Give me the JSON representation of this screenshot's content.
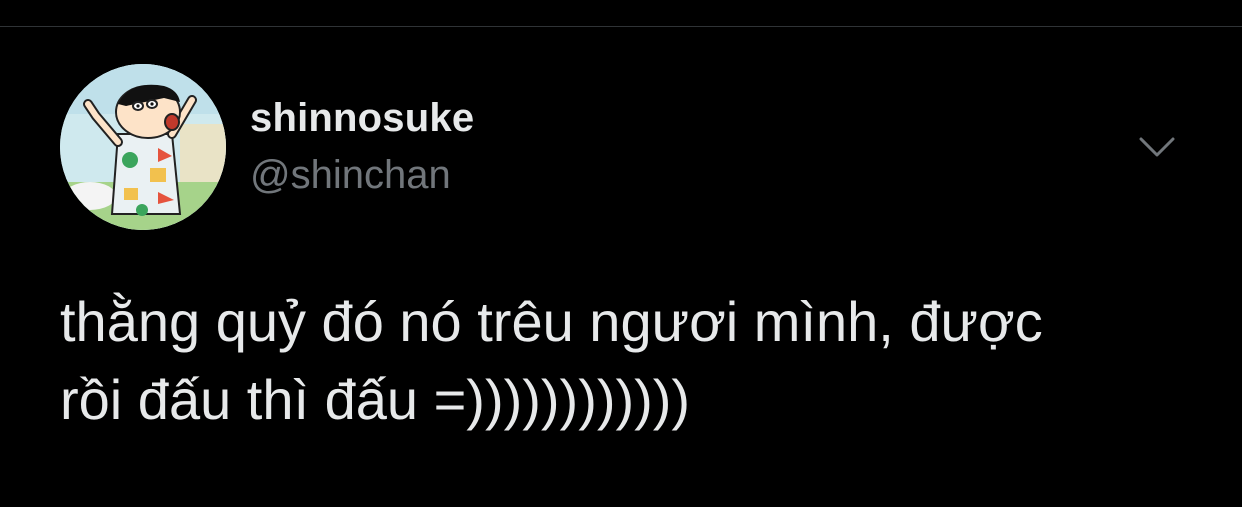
{
  "tweet": {
    "author": {
      "display_name": "shinnosuke",
      "handle": "@shinchan",
      "avatar_icon": "shinchan-avatar-icon"
    },
    "more_icon": "chevron-down-icon",
    "text": "thằng quỷ đó nó trêu ngươi mình, được\nrồi đấu thì đấu =))))))))))))"
  },
  "colors": {
    "background": "#000000",
    "primary_text": "#e7e9ea",
    "secondary_text": "#71767b",
    "divider": "#2f3336"
  }
}
